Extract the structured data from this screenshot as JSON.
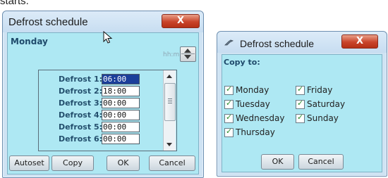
{
  "caption": "starts.",
  "left_window": {
    "title": "Defrost schedule",
    "close_label": "X",
    "day_heading": "Monday",
    "time_format": "hh:mm",
    "rows": [
      {
        "label": "Defrost 1:",
        "value": "06:00"
      },
      {
        "label": "Defrost 2:",
        "value": "18:00"
      },
      {
        "label": "Defrost 3:",
        "value": "00:00"
      },
      {
        "label": "Defrost 4:",
        "value": "00:00"
      },
      {
        "label": "Defrost 5:",
        "value": "00:00"
      },
      {
        "label": "Defrost 6:",
        "value": "00:00"
      }
    ],
    "buttons": {
      "autoset": "Autoset",
      "copy": "Copy",
      "ok": "OK",
      "cancel": "Cancel"
    }
  },
  "right_window": {
    "title": "Defrost schedule",
    "close_label": "X",
    "heading": "Copy to:",
    "days": [
      {
        "label": "Monday",
        "checked": true
      },
      {
        "label": "Friday",
        "checked": true
      },
      {
        "label": "Tuesday",
        "checked": true
      },
      {
        "label": "Saturday",
        "checked": true
      },
      {
        "label": "Wednesday",
        "checked": true
      },
      {
        "label": "Sunday",
        "checked": true
      },
      {
        "label": "Thursday",
        "checked": true
      }
    ],
    "buttons": {
      "ok": "OK",
      "cancel": "Cancel"
    }
  }
}
